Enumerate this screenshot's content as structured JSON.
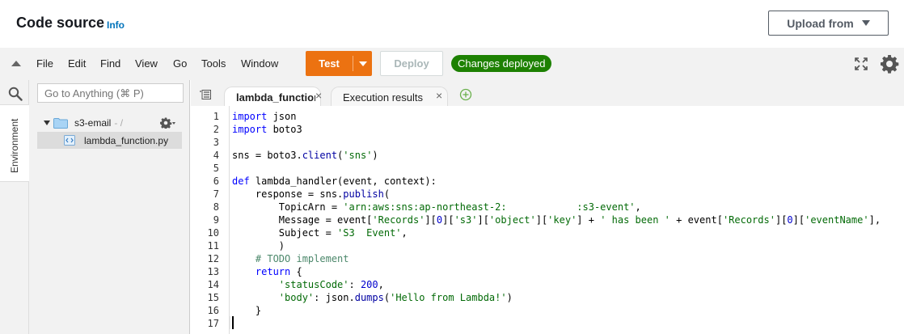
{
  "header": {
    "title": "Code source",
    "info_link": "Info",
    "upload_label": "Upload from"
  },
  "menu": [
    "File",
    "Edit",
    "Find",
    "View",
    "Go",
    "Tools",
    "Window"
  ],
  "toolbar": {
    "test_label": "Test",
    "deploy_label": "Deploy",
    "status_badge": "Changes deployed",
    "accent_color": "#ec7211",
    "status_color": "#1d8102"
  },
  "sidebar": {
    "env_tab": "Environment",
    "goto_placeholder": "Go to Anything (⌘ P)",
    "folder_name": "s3-email",
    "folder_path": "- /",
    "file_name": "lambda_function.py"
  },
  "tabs": [
    {
      "label": "lambda_function"
    },
    {
      "label": "Execution results"
    }
  ],
  "code_lines": [
    "import json",
    "import boto3",
    "",
    "sns = boto3.client('sns')",
    "",
    "def lambda_handler(event, context):",
    "    response = sns.publish(",
    "        TopicArn = 'arn:aws:sns:ap-northeast-2:            :s3-event',",
    "        Message = event['Records'][0]['s3']['object']['key'] + ' has been ' + event['Records'][0]['eventName'],",
    "        Subject = 'S3  Event',",
    "        )",
    "    # TODO implement",
    "    return {",
    "        'statusCode': 200,",
    "        'body': json.dumps('Hello from Lambda!')",
    "    }",
    ""
  ],
  "cursor_line": 17
}
